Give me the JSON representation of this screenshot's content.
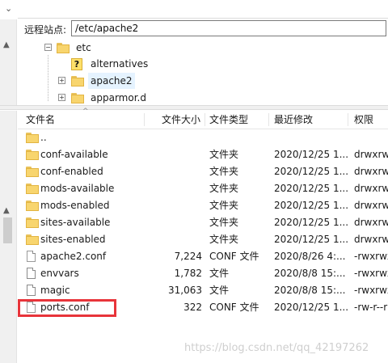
{
  "top_bar": {
    "chevron": "⌄"
  },
  "path_bar": {
    "label": "远程站点:",
    "value": "/etc/apache2"
  },
  "tree": {
    "nodes": [
      {
        "label": "etc",
        "icon": "folder-icon"
      },
      {
        "label": "alternatives",
        "icon": "unknown-folder-icon"
      },
      {
        "label": "apache2",
        "icon": "folder-icon",
        "selected": true
      },
      {
        "label": "apparmor.d",
        "icon": "folder-icon"
      }
    ]
  },
  "columns": {
    "name": "文件名",
    "size": "文件大小",
    "type": "文件类型",
    "modified": "最近修改",
    "perm": "权限"
  },
  "rows": [
    {
      "name": "..",
      "kind": "folder",
      "size": "",
      "type": "",
      "modified": "",
      "perm": ""
    },
    {
      "name": "conf-available",
      "kind": "folder",
      "size": "",
      "type": "文件夹",
      "modified": "2020/12/25 1...",
      "perm": "drwxrwx"
    },
    {
      "name": "conf-enabled",
      "kind": "folder",
      "size": "",
      "type": "文件夹",
      "modified": "2020/12/25 1...",
      "perm": "drwxrwx"
    },
    {
      "name": "mods-available",
      "kind": "folder",
      "size": "",
      "type": "文件夹",
      "modified": "2020/12/25 1...",
      "perm": "drwxrwx"
    },
    {
      "name": "mods-enabled",
      "kind": "folder",
      "size": "",
      "type": "文件夹",
      "modified": "2020/12/25 1...",
      "perm": "drwxrwx"
    },
    {
      "name": "sites-available",
      "kind": "folder",
      "size": "",
      "type": "文件夹",
      "modified": "2020/12/25 1...",
      "perm": "drwxrwx"
    },
    {
      "name": "sites-enabled",
      "kind": "folder",
      "size": "",
      "type": "文件夹",
      "modified": "2020/12/25 1...",
      "perm": "drwxrwx"
    },
    {
      "name": "apache2.conf",
      "kind": "file",
      "size": "7,224",
      "type": "CONF 文件",
      "modified": "2020/8/26 4:...",
      "perm": "-rwxrwx"
    },
    {
      "name": "envvars",
      "kind": "file",
      "size": "1,782",
      "type": "文件",
      "modified": "2020/8/8 15:...",
      "perm": "-rwxrwx"
    },
    {
      "name": "magic",
      "kind": "file",
      "size": "31,063",
      "type": "文件",
      "modified": "2020/8/8 15:...",
      "perm": "-rwxrwx"
    },
    {
      "name": "ports.conf",
      "kind": "file",
      "size": "322",
      "type": "CONF 文件",
      "modified": "2020/12/25 1...",
      "perm": "-rw-r--r"
    }
  ],
  "watermark": "https://blog.csdn.net/qq_42197262",
  "colors": {
    "highlight": "#e8343a",
    "folder": "#f8d56e",
    "selection": "#e5f3ff"
  }
}
